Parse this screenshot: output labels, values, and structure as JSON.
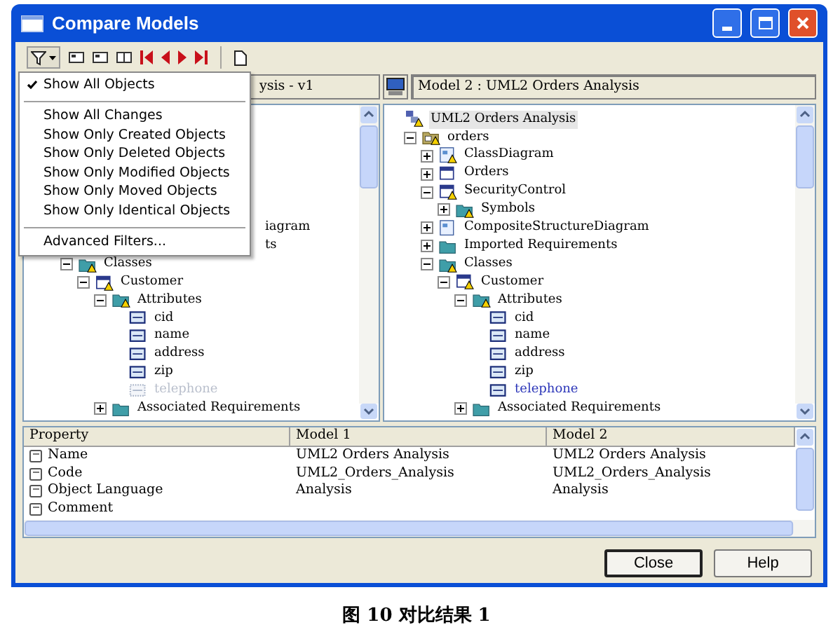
{
  "window": {
    "title": "Compare Models"
  },
  "filter_menu": {
    "items": [
      {
        "kind": "option",
        "label": "Show All Objects",
        "checked": true
      },
      {
        "kind": "separator"
      },
      {
        "kind": "option",
        "label": "Show All Changes",
        "checked": false
      },
      {
        "kind": "option",
        "label": "Show Only Created Objects",
        "checked": false
      },
      {
        "kind": "option",
        "label": "Show Only Deleted Objects",
        "checked": false
      },
      {
        "kind": "option",
        "label": "Show Only Modified Objects",
        "checked": false
      },
      {
        "kind": "option",
        "label": "Show Only Moved Objects",
        "checked": false
      },
      {
        "kind": "option",
        "label": "Show Only Identical Objects",
        "checked": false
      },
      {
        "kind": "separator"
      },
      {
        "kind": "option",
        "label": "Advanced Filters...",
        "checked": false
      }
    ]
  },
  "left_pane": {
    "header": "ysis - v1",
    "fragments": [
      "iagram",
      "ts"
    ],
    "tree": [
      {
        "label": "Classes",
        "kind": "folder",
        "flagged": true,
        "expanded": true,
        "children": [
          {
            "label": "Customer",
            "kind": "class",
            "flagged": true,
            "expanded": true,
            "children": [
              {
                "label": "Attributes",
                "kind": "folder",
                "flagged": true,
                "expanded": true,
                "children": [
                  {
                    "label": "cid",
                    "kind": "attribute",
                    "flagged": false
                  },
                  {
                    "label": "name",
                    "kind": "attribute",
                    "flagged": false
                  },
                  {
                    "label": "address",
                    "kind": "attribute",
                    "flagged": false
                  },
                  {
                    "label": "zip",
                    "kind": "attribute",
                    "flagged": false
                  },
                  {
                    "label": "telephone",
                    "kind": "attribute",
                    "flagged": false,
                    "dimmed": true
                  }
                ]
              },
              {
                "label": "Associated Requirements",
                "kind": "folder",
                "flagged": false,
                "expanded": false
              }
            ]
          }
        ]
      }
    ]
  },
  "right_pane": {
    "header": "Model 2 : UML2 Orders Analysis",
    "tree": [
      {
        "label": "UML2 Orders Analysis",
        "kind": "model",
        "flagged": true,
        "children": [
          {
            "label": "orders",
            "kind": "package",
            "flagged": true,
            "expanded": true,
            "children": [
              {
                "label": "ClassDiagram",
                "kind": "diagram",
                "flagged": true,
                "expanded": false
              },
              {
                "label": "Orders",
                "kind": "class",
                "flagged": false,
                "expanded": false
              },
              {
                "label": "SecurityControl",
                "kind": "class",
                "flagged": true,
                "expanded": true,
                "children": [
                  {
                    "label": "Symbols",
                    "kind": "folder",
                    "flagged": true,
                    "expanded": false
                  }
                ]
              },
              {
                "label": "CompositeStructureDiagram",
                "kind": "diagram",
                "flagged": false,
                "expanded": false
              },
              {
                "label": "Imported Requirements",
                "kind": "folder",
                "flagged": false,
                "expanded": false
              },
              {
                "label": "Classes",
                "kind": "folder",
                "flagged": true,
                "expanded": true,
                "children": [
                  {
                    "label": "Customer",
                    "kind": "class",
                    "flagged": true,
                    "expanded": true,
                    "children": [
                      {
                        "label": "Attributes",
                        "kind": "folder",
                        "flagged": true,
                        "expanded": true,
                        "children": [
                          {
                            "label": "cid",
                            "kind": "attribute",
                            "flagged": false
                          },
                          {
                            "label": "name",
                            "kind": "attribute",
                            "flagged": false
                          },
                          {
                            "label": "address",
                            "kind": "attribute",
                            "flagged": false
                          },
                          {
                            "label": "zip",
                            "kind": "attribute",
                            "flagged": false
                          },
                          {
                            "label": "telephone",
                            "kind": "attribute",
                            "flagged": false,
                            "highlighted": true
                          }
                        ]
                      },
                      {
                        "label": "Associated Requirements",
                        "kind": "folder",
                        "flagged": false,
                        "expanded": false
                      }
                    ]
                  }
                ]
              }
            ]
          }
        ]
      }
    ]
  },
  "properties": {
    "columns": [
      "Property",
      "Model 1",
      "Model 2"
    ],
    "rows": [
      [
        "Name",
        "UML2 Orders Analysis",
        "UML2 Orders Analysis"
      ],
      [
        "Code",
        "UML2_Orders_Analysis",
        "UML2_Orders_Analysis"
      ],
      [
        "Object Language",
        "Analysis",
        "Analysis"
      ],
      [
        "Comment",
        "",
        ""
      ]
    ]
  },
  "buttons": [
    {
      "label": "Close",
      "default": true
    },
    {
      "label": "Help",
      "default": false
    }
  ],
  "caption": "图 10 对比结果 1"
}
